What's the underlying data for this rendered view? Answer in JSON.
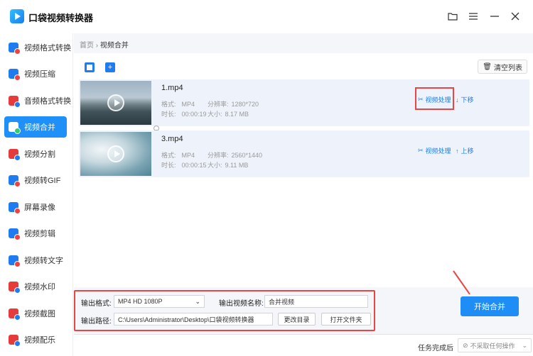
{
  "app": {
    "title": "口袋视频转换器",
    "icon": "app-logo-icon"
  },
  "window_controls": [
    {
      "name": "folder-icon",
      "glyph": "🗀"
    },
    {
      "name": "menu-icon",
      "glyph": "☰"
    },
    {
      "name": "minimize-icon",
      "glyph": "—"
    },
    {
      "name": "close-icon",
      "glyph": "✕"
    }
  ],
  "sidebar": {
    "items": [
      {
        "label": "视频格式转换",
        "active": false
      },
      {
        "label": "视频压缩",
        "active": false
      },
      {
        "label": "音频格式转换",
        "active": false
      },
      {
        "label": "视频合并",
        "active": true
      },
      {
        "label": "视频分割",
        "active": false
      },
      {
        "label": "视频转GIF",
        "active": false
      },
      {
        "label": "屏幕录像",
        "active": false
      },
      {
        "label": "视频剪辑",
        "active": false
      },
      {
        "label": "视频转文字",
        "active": false
      },
      {
        "label": "视频水印",
        "active": false
      },
      {
        "label": "视频截图",
        "active": false
      },
      {
        "label": "视频配乐",
        "active": false
      }
    ]
  },
  "breadcrumb": {
    "home": "首页",
    "sep": "›",
    "current": "视频合并"
  },
  "toolbar": {
    "clear_label": "清空列表"
  },
  "files": [
    {
      "name": "1.mp4",
      "format_label": "格式:",
      "format": "MP4",
      "resolution_label": "分辨率:",
      "resolution": "1280*720",
      "duration_label": "时长:",
      "duration": "00:00:19",
      "size_label": "大小:",
      "size": "8.17 MB",
      "process_label": "视频处理",
      "move_label": "下移",
      "move_arrow": "↓"
    },
    {
      "name": "3.mp4",
      "format_label": "格式:",
      "format": "MP4",
      "resolution_label": "分辨率:",
      "resolution": "2560*1440",
      "duration_label": "时长:",
      "duration": "00:00:15",
      "size_label": "大小:",
      "size": "9.11 MB",
      "process_label": "视频处理",
      "move_label": "上移",
      "move_arrow": "↑"
    }
  ],
  "output": {
    "format_label": "输出格式:",
    "format_value": "MP4   HD 1080P",
    "name_label": "输出视频名称:",
    "name_value": "合并视频",
    "path_label": "输出路径:",
    "path_value": "C:\\Users\\Administrator\\Desktop\\口袋视频转换器",
    "change_dir_label": "更改目录",
    "open_folder_label": "打开文件夹"
  },
  "start_button": "开始合并",
  "status": {
    "label": "任务完成后",
    "select_value": "不采取任何操作"
  },
  "colors": {
    "accent": "#1e8df5",
    "highlight": "#e84545"
  }
}
